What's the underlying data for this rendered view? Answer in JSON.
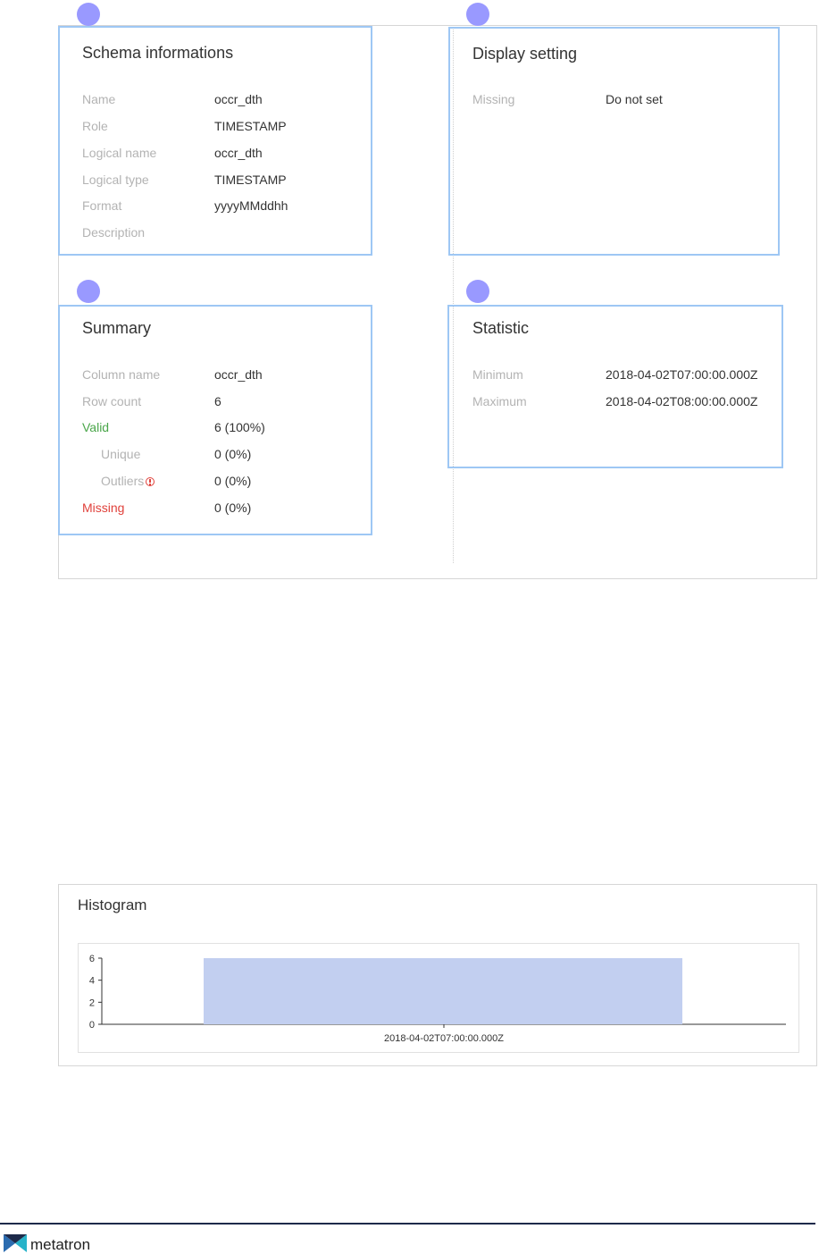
{
  "schema": {
    "title": "Schema informations",
    "rows": [
      {
        "label": "Name",
        "value": "occr_dth"
      },
      {
        "label": "Role",
        "value": "TIMESTAMP"
      },
      {
        "label": "Logical name",
        "value": "occr_dth"
      },
      {
        "label": "Logical type",
        "value": "TIMESTAMP"
      },
      {
        "label": "Format",
        "value": "yyyyMMddhh"
      },
      {
        "label": "Description",
        "value": ""
      }
    ]
  },
  "display": {
    "title": "Display setting",
    "rows": [
      {
        "label": "Missing",
        "value": "Do not set"
      }
    ]
  },
  "summary": {
    "title": "Summary",
    "rows": [
      {
        "label": "Column name",
        "value": "occr_dth"
      },
      {
        "label": "Row count",
        "value": "6"
      },
      {
        "label": "Valid",
        "value": "6 (100%)"
      },
      {
        "label": "Unique",
        "value": "0 (0%)"
      },
      {
        "label": "Outliers",
        "value": "0 (0%)"
      },
      {
        "label": "Missing",
        "value": "0 (0%)"
      }
    ]
  },
  "statistic": {
    "title": "Statistic",
    "rows": [
      {
        "label": "Minimum",
        "value": "2018-04-02T07:00:00.000Z"
      },
      {
        "label": "Maximum",
        "value": "2018-04-02T08:00:00.000Z"
      }
    ]
  },
  "histogram": {
    "title": "Histogram"
  },
  "chart_data": {
    "type": "bar",
    "categories": [
      "2018-04-02T07:00:00.000Z"
    ],
    "values": [
      6
    ],
    "ylim": [
      0,
      6
    ],
    "yticks": [
      "0",
      "2",
      "4",
      "6"
    ],
    "bar_color": "#c2cff0"
  },
  "colors": {
    "highlight_border": "#9ec7f4",
    "badge": "#9999ff",
    "valid": "#4aa64a",
    "missing": "#e0413b"
  },
  "footer": {
    "brand": "metatron"
  }
}
